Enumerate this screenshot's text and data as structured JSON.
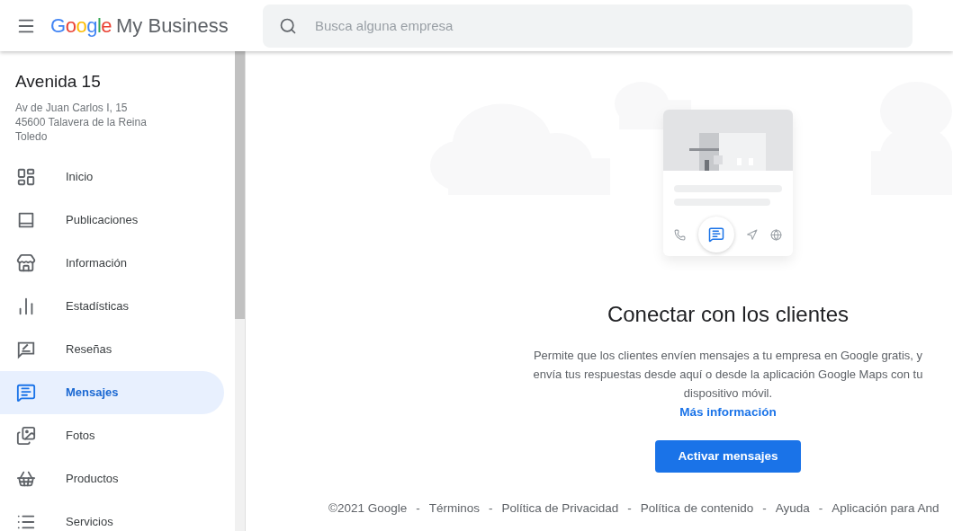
{
  "header": {
    "logo": [
      {
        "text": "G",
        "color": "#4285f4"
      },
      {
        "text": "o",
        "color": "#ea4335"
      },
      {
        "text": "o",
        "color": "#fbbc05"
      },
      {
        "text": "g",
        "color": "#4285f4"
      },
      {
        "text": "l",
        "color": "#34a853"
      },
      {
        "text": "e",
        "color": "#ea4335"
      }
    ],
    "product": "My Business",
    "search": {
      "placeholder": "Busca alguna empresa"
    }
  },
  "business": {
    "name": "Avenida 15",
    "address": [
      "Av de Juan Carlos I, 15",
      "45600 Talavera de la Reina",
      "Toledo"
    ]
  },
  "sidebar": {
    "items": [
      {
        "label": "Inicio",
        "selected": false
      },
      {
        "label": "Publicaciones",
        "selected": false
      },
      {
        "label": "Información",
        "selected": false
      },
      {
        "label": "Estadísticas",
        "selected": false
      },
      {
        "label": "Reseñas",
        "selected": false
      },
      {
        "label": "Mensajes",
        "selected": true
      },
      {
        "label": "Fotos",
        "selected": false
      },
      {
        "label": "Productos",
        "selected": false
      },
      {
        "label": "Servicios",
        "selected": false
      }
    ]
  },
  "main": {
    "title": "Conectar con los clientes",
    "description": "Permite que los clientes envíen mensajes a tu empresa en Google gratis, y envía tus respuestas desde aquí o desde la aplicación Google Maps con tu dispositivo móvil.",
    "link": "Más información",
    "button": "Activar mensajes"
  },
  "footer": {
    "copyright": "©2021 Google",
    "links": [
      {
        "separator": "-",
        "text": "Términos"
      },
      {
        "separator": "-",
        "text": "Política de Privacidad"
      },
      {
        "separator": "-",
        "text": "Política de contenido"
      },
      {
        "separator": "-",
        "text": "Ayuda"
      },
      {
        "separator": "-",
        "text": "Aplicación para And"
      }
    ]
  }
}
